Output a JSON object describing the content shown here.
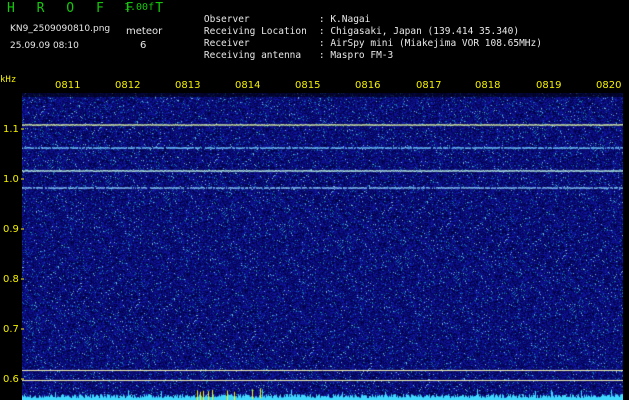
{
  "header": {
    "app_title": "H R O F F T",
    "version": "1.00f",
    "filename": "KN9_2509090810.png",
    "meteor_label": "meteor",
    "meteor_count": "6",
    "datetime": "25.09.09 08:10"
  },
  "station_info": [
    {
      "label": "Observer",
      "value": ": K.Nagai"
    },
    {
      "label": "Receiving Location",
      "value": ": Chigasaki, Japan (139.414 35.340)"
    },
    {
      "label": "Receiver",
      "value": ": AirSpy mini (Miakejima VOR 108.65MHz)"
    },
    {
      "label": "Receiving antenna",
      "value": ": Maspro FM-3"
    }
  ],
  "axis": {
    "unit_label": "kHz",
    "time_labels": [
      "0811",
      "0812",
      "0813",
      "0814",
      "0815",
      "0816",
      "0817",
      "0818",
      "0819",
      "0820"
    ],
    "freq_labels": [
      "1.1",
      "1.0",
      "0.9",
      "0.8",
      "0.7",
      "0.6"
    ]
  },
  "colors": {
    "text_green": "#16c80c",
    "text_white": "#e8e8e8",
    "text_yellow": "#f4f000",
    "background_noise": "#1a1f8c",
    "carrier_line": "#6fc8ff",
    "reference_line": "#f0f0b0",
    "power_baseline": "#3fd8ff"
  }
}
